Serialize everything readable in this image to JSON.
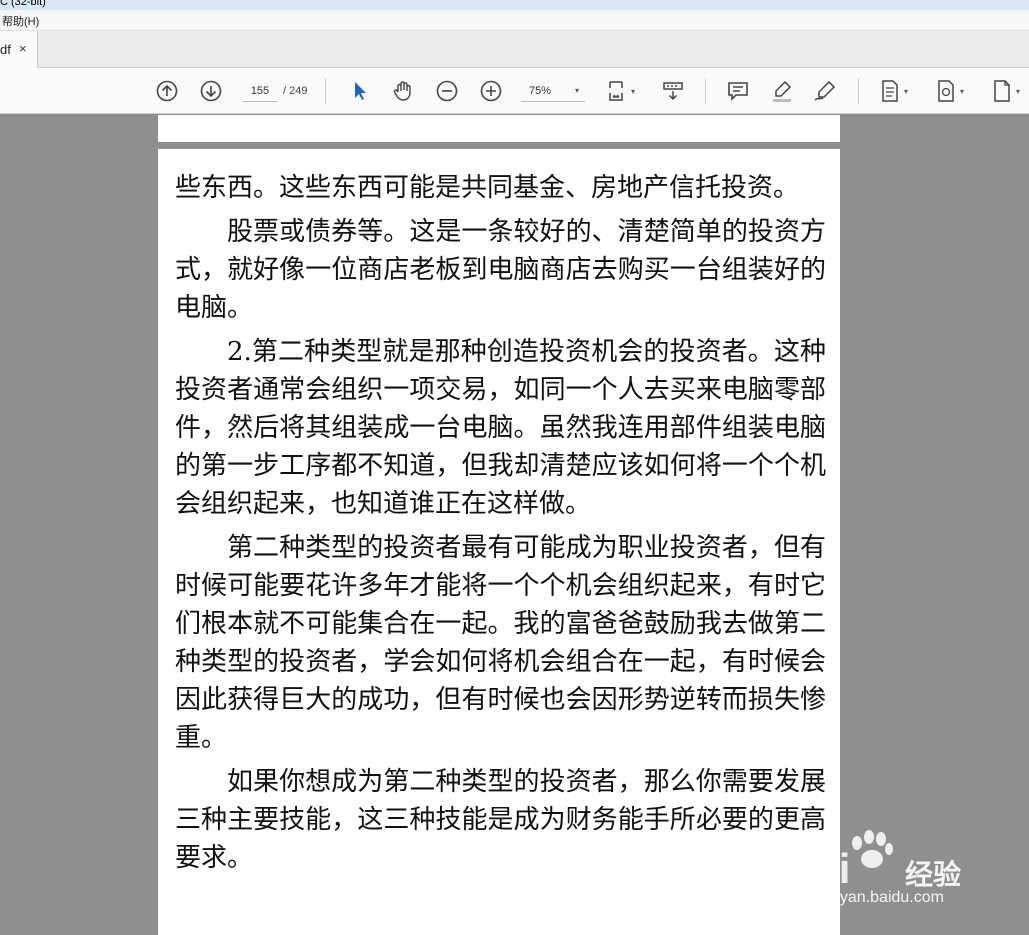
{
  "window": {
    "title": "C (32-bit)"
  },
  "menu": {
    "help": "帮助(H)"
  },
  "tab": {
    "label": "df",
    "close": "×"
  },
  "toolbar": {
    "page_current": "155",
    "page_total": "/ 249",
    "zoom": "75%",
    "caret": "▾",
    "icons": [
      "arrow-up-circle-icon",
      "arrow-down-circle-icon",
      "select-cursor-icon",
      "hand-icon",
      "zoom-out-icon",
      "zoom-in-icon",
      "fit-page-icon",
      "scroll-mode-icon",
      "comment-icon",
      "highlight-icon",
      "sign-icon",
      "page-icon",
      "page-add-icon",
      "document-icon"
    ]
  },
  "document": {
    "paragraphs": [
      {
        "text": "些东西。这些东西可能是共同基金、房地产信托投资。",
        "indent": false
      },
      {
        "text": "股票或债券等。这是一条较好的、清楚简单的投资方式，就好像一位商店老板到电脑商店去购买一台组装好的电脑。",
        "indent": true
      },
      {
        "text": "2.第二种类型就是那种创造投资机会的投资者。这种投资者通常会组织一项交易，如同一个人去买来电脑零部件，然后将其组装成一台电脑。虽然我连用部件组装电脑的第一步工序都不知道，但我却清楚应该如何将一个个机会组织起来，也知道谁正在这样做。",
        "indent": true
      },
      {
        "text": "第二种类型的投资者最有可能成为职业投资者，但有时候可能要花许多年才能将一个个机会组织起来，有时它们根本就不可能集合在一起。我的富爸爸鼓励我去做第二种类型的投资者，学会如何将机会组合在一起，有时候会因此获得巨大的成功，但有时候也会因形势逆转而损失惨重。",
        "indent": true
      },
      {
        "text": "如果你想成为第二种类型的投资者，那么你需要发展三种主要技能，这三种技能是成为财务能手所必要的更高要求。",
        "indent": true
      }
    ]
  },
  "watermark": {
    "brand": "Bai",
    "brand2": "经验",
    "url": "jingyan.baidu.com"
  }
}
